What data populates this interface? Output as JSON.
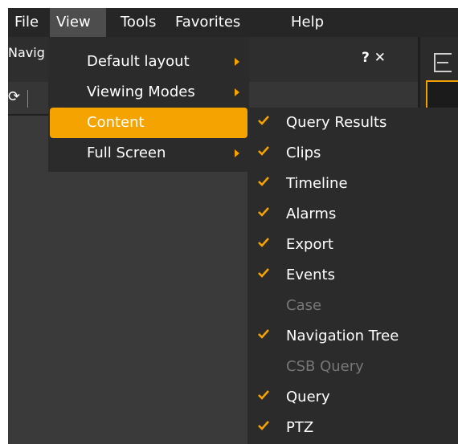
{
  "colors": {
    "accent": "#f5a300",
    "menu_bg": "#2b2b2b",
    "disabled_text": "#777777"
  },
  "menubar": {
    "items": [
      {
        "label": "File"
      },
      {
        "label": "View"
      },
      {
        "label": "Tools"
      },
      {
        "label": "Favorites"
      },
      {
        "label": "Help"
      }
    ]
  },
  "panel": {
    "title": "Navig",
    "buttons": "? ✕",
    "refresh_glyph": "⟳"
  },
  "view_menu": {
    "items": [
      {
        "label": "Default layout",
        "submenu": true
      },
      {
        "label": "Viewing Modes",
        "submenu": true
      },
      {
        "label": "Content",
        "submenu": true,
        "highlighted": true
      },
      {
        "label": "Full Screen",
        "submenu": true
      }
    ]
  },
  "content_menu": {
    "items": [
      {
        "label": "Query Results",
        "checked": true,
        "enabled": true
      },
      {
        "label": "Clips",
        "checked": true,
        "enabled": true
      },
      {
        "label": "Timeline",
        "checked": true,
        "enabled": true
      },
      {
        "label": "Alarms",
        "checked": true,
        "enabled": true
      },
      {
        "label": "Export",
        "checked": true,
        "enabled": true
      },
      {
        "label": "Events",
        "checked": true,
        "enabled": true
      },
      {
        "label": "Case",
        "checked": false,
        "enabled": false
      },
      {
        "label": "Navigation Tree",
        "checked": true,
        "enabled": true
      },
      {
        "label": "CSB Query",
        "checked": false,
        "enabled": false
      },
      {
        "label": "Query",
        "checked": true,
        "enabled": true
      },
      {
        "label": "PTZ",
        "checked": true,
        "enabled": true
      }
    ]
  }
}
